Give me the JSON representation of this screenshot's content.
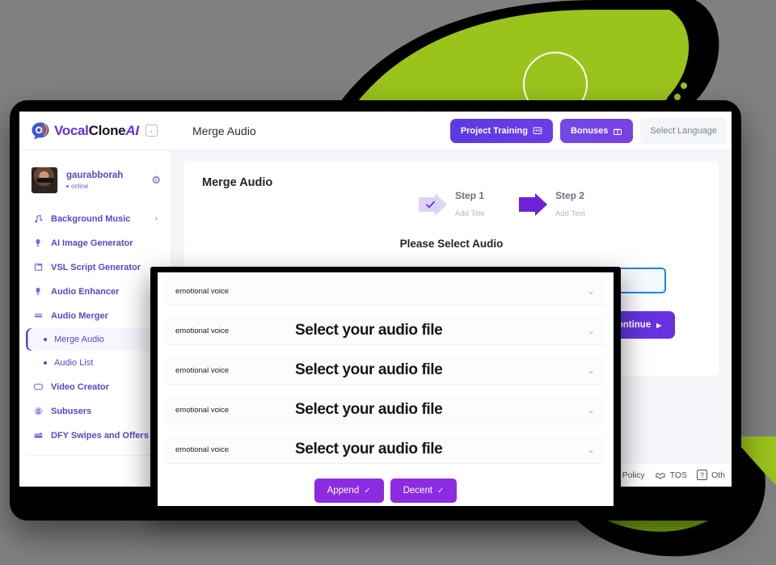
{
  "app": {
    "brand": {
      "part1": "Vocal",
      "part2": "Clone",
      "part3": "AI",
      "collapse_icon": "chevron-left-icon"
    },
    "header_title": "Merge Audio",
    "buttons": {
      "project_training": "Project Training",
      "bonuses": "Bonuses",
      "select_language": "Select Language"
    }
  },
  "profile": {
    "name": "gaurabborah",
    "status": "online",
    "settings_icon": "gear-icon"
  },
  "sidebar": {
    "items": [
      {
        "label": "Background Music",
        "icon": "music-note-icon",
        "chevron": "›",
        "type": "parent",
        "active": false
      },
      {
        "label": "AI Image Generator",
        "icon": "image-ai-icon",
        "chevron": "",
        "type": "item",
        "active": false
      },
      {
        "label": "VSL Script Generator",
        "icon": "script-icon",
        "chevron": "",
        "type": "item",
        "active": false
      },
      {
        "label": "Audio Enhancer",
        "icon": "microphone-icon",
        "chevron": "›",
        "type": "parent",
        "active": false
      },
      {
        "label": "Audio Merger",
        "icon": "merge-icon",
        "chevron": "",
        "type": "item",
        "active": false
      },
      {
        "label": "Merge Audio",
        "icon": "bullet-icon",
        "chevron": "",
        "type": "sub",
        "active": true
      },
      {
        "label": "Audio List",
        "icon": "bullet-icon",
        "chevron": "",
        "type": "sub",
        "active": false
      },
      {
        "label": "Video Creator",
        "icon": "video-icon",
        "chevron": "›",
        "type": "parent",
        "active": false
      },
      {
        "label": "Subusers",
        "icon": "user-circle-icon",
        "chevron": "›",
        "type": "parent",
        "active": false
      },
      {
        "label": "DFY Swipes and Offers",
        "icon": "gift-swipe-icon",
        "chevron": "",
        "type": "item",
        "active": false
      }
    ]
  },
  "main": {
    "card_title": "Merge Audio",
    "steps": [
      {
        "name": "Step 1",
        "sub": "Add Title",
        "state": "done"
      },
      {
        "name": "Step 2",
        "sub": "Add Text",
        "state": "current"
      }
    ],
    "section_heading": "Please Select Audio",
    "input_value": "",
    "continue_label": "Continue",
    "continue_icon": "chevron-right-icon"
  },
  "footer": {
    "links": [
      {
        "label": "ookies Policy",
        "icon": ""
      },
      {
        "label": "TOS",
        "icon": "handshake-icon"
      },
      {
        "label": "Oth",
        "icon": "question-icon"
      }
    ]
  },
  "modal": {
    "rows": [
      {
        "voice": "emotional voice",
        "file": "",
        "chevron": "chevron-down-icon"
      },
      {
        "voice": "emotional voice",
        "file": "Select your audio file",
        "chevron": "chevron-down-icon"
      },
      {
        "voice": "emotional voice",
        "file": "Select your audio file",
        "chevron": "chevron-down-icon"
      },
      {
        "voice": "emotional voice",
        "file": "Select your audio file",
        "chevron": "chevron-down-icon"
      },
      {
        "voice": "emotional voice",
        "file": "Select your audio file",
        "chevron": "chevron-down-icon"
      }
    ],
    "actions": [
      {
        "label": "Append",
        "icon": "check-icon"
      },
      {
        "label": "Decent",
        "icon": "check-icon"
      }
    ]
  },
  "colors": {
    "background": "#808080",
    "brand_purple": "#6532e0",
    "accent_green": "#9ac31c",
    "modal_button": "#8b2be2",
    "input_focus": "#1b84f5",
    "sidebar_text": "#5b46c8"
  }
}
